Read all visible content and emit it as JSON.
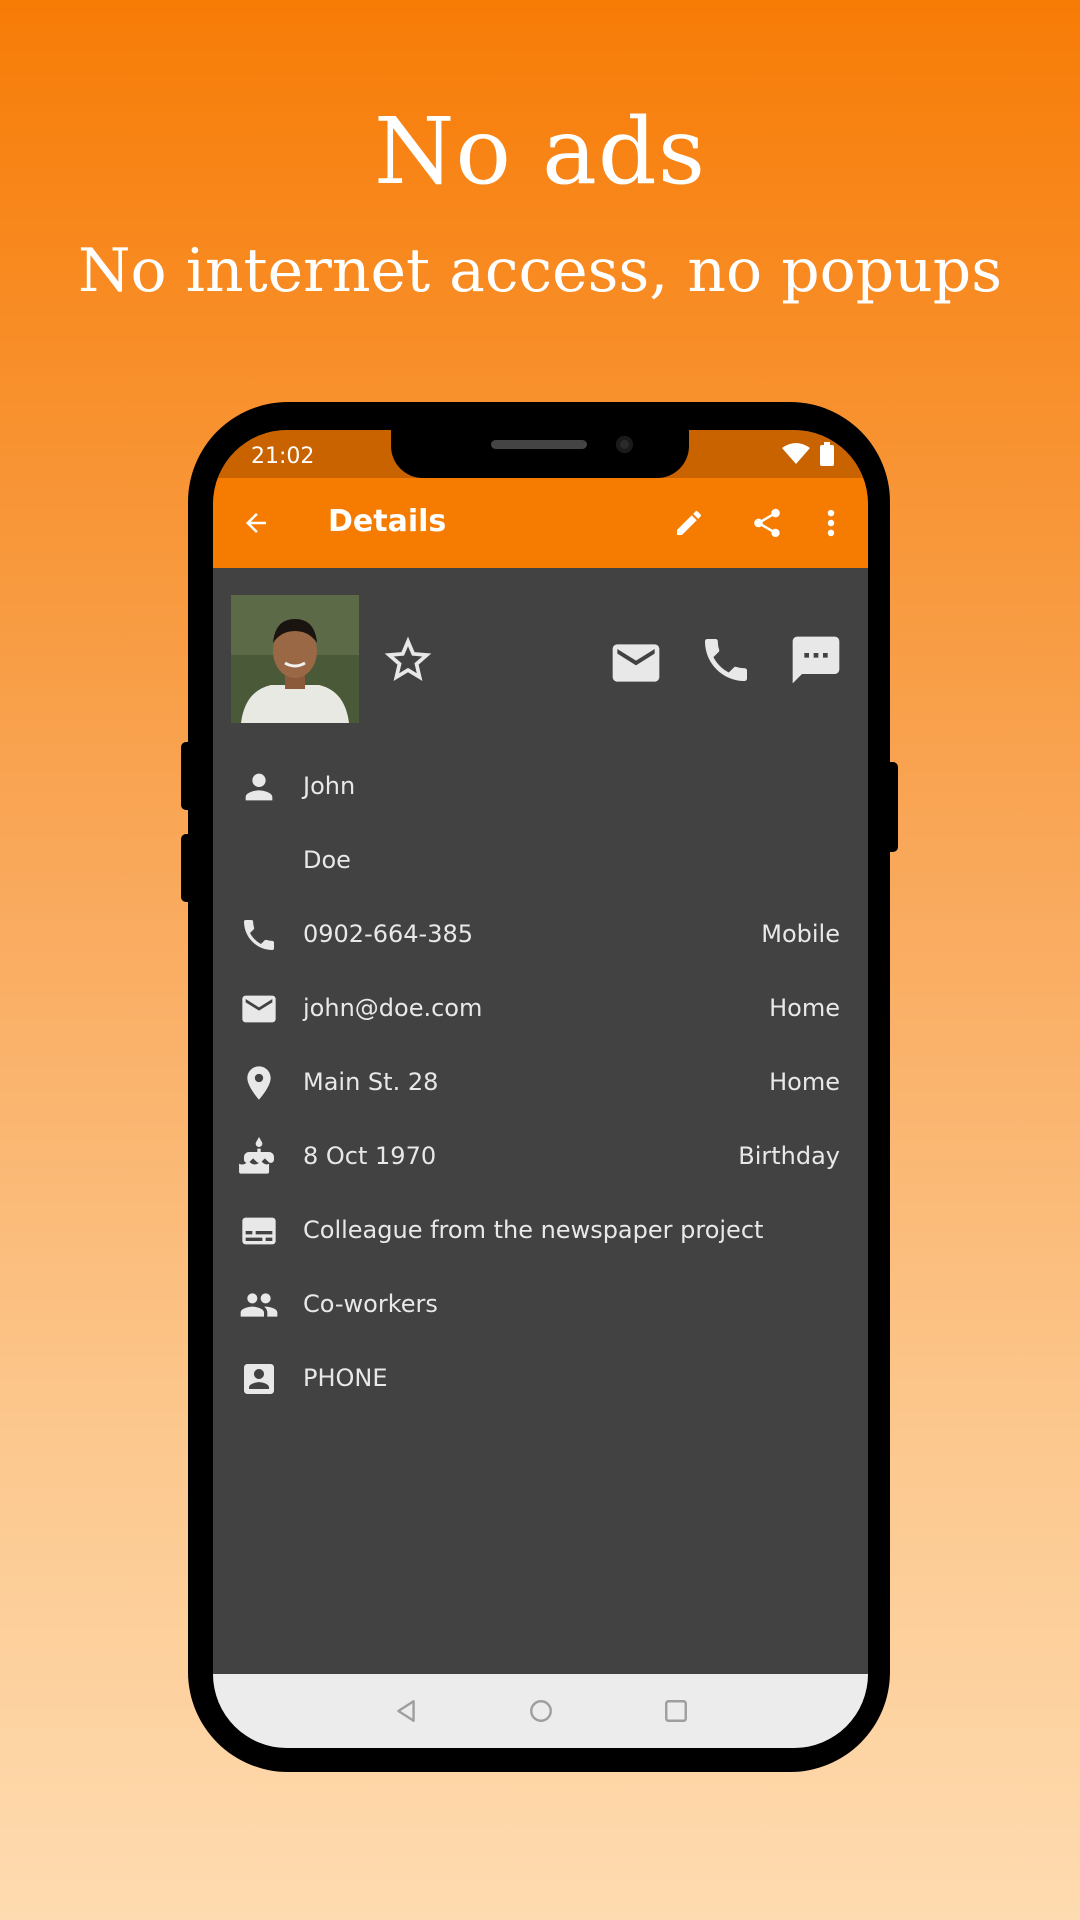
{
  "promo": {
    "title": "No ads",
    "subtitle": "No internet access, no popups"
  },
  "status_bar": {
    "time": "21:02",
    "icons": [
      "wifi-icon",
      "battery-icon"
    ]
  },
  "toolbar": {
    "title": "Details",
    "actions": [
      "back-arrow-icon",
      "edit-icon",
      "share-icon",
      "more-vert-icon"
    ]
  },
  "contact_header": {
    "quick_actions": [
      "star-icon",
      "email-icon",
      "phone-icon",
      "sms-icon"
    ]
  },
  "details": {
    "first_name": "John",
    "last_name": "Doe",
    "phone": {
      "value": "0902-664-385",
      "type": "Mobile"
    },
    "email": {
      "value": "john@doe.com",
      "type": "Home"
    },
    "address": {
      "value": "Main St. 28",
      "type": "Home"
    },
    "event": {
      "value": "8 Oct 1970",
      "type": "Birthday"
    },
    "notes": "Colleague from the newspaper project",
    "groups": "Co-workers",
    "source": "PHONE"
  },
  "colors": {
    "accent": "#f57c00",
    "status_bar": "#c86300",
    "background": "#424242",
    "text": "#e8e8e8"
  }
}
